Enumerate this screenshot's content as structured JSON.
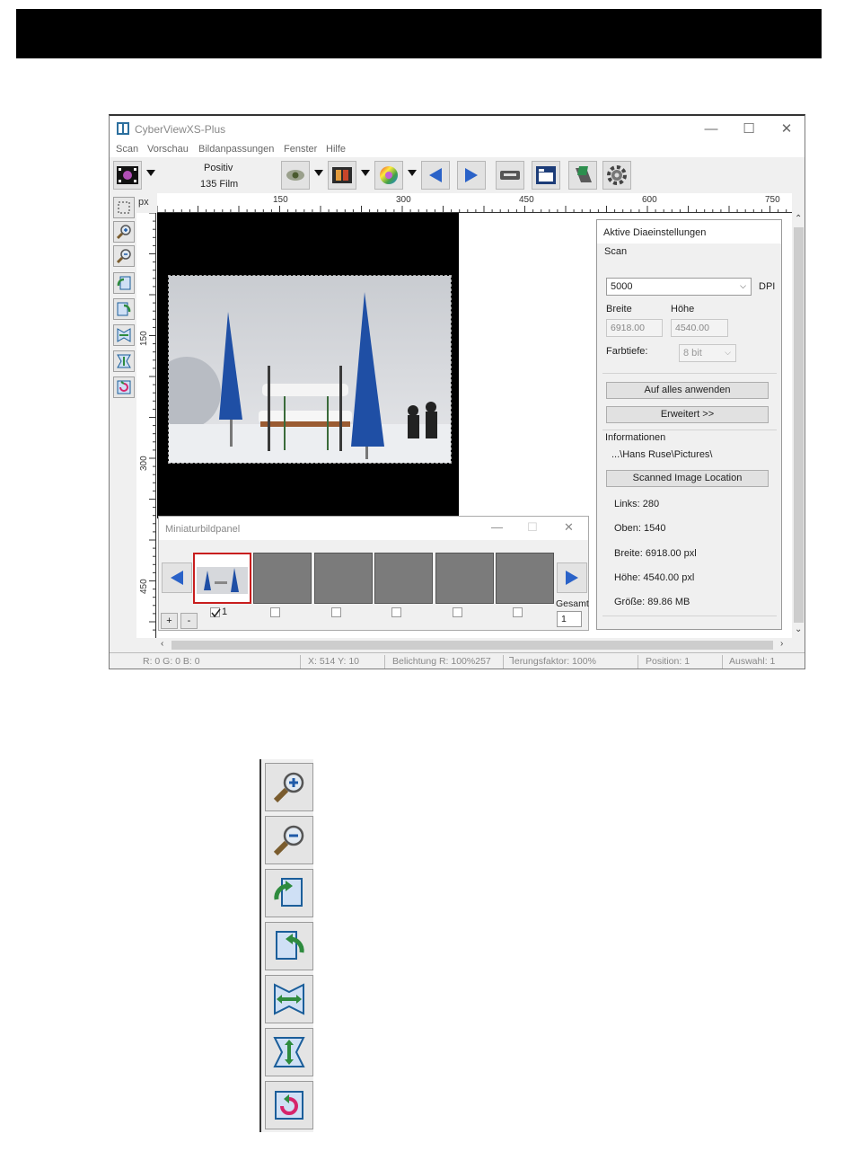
{
  "window": {
    "title": "CyberViewXS-Plus",
    "minimize": "—",
    "maximize": "☐",
    "close": "✕"
  },
  "menu": [
    "Scan",
    "Vorschau",
    "Bildanpassungen",
    "Fenster",
    "Hilfe"
  ],
  "toolbar": {
    "mode_line1": "Positiv",
    "mode_line2": "135 Film"
  },
  "ruler": {
    "unit": "px",
    "h_ticks": [
      "150",
      "300",
      "450",
      "600",
      "750"
    ],
    "v_ticks": [
      "150",
      "300",
      "450"
    ]
  },
  "settings_panel": {
    "title": "Aktive Diaeinstellungen",
    "scan_label": "Scan",
    "dpi_value": "5000",
    "dpi_unit": "DPI",
    "width_label": "Breite",
    "height_label": "Höhe",
    "width_value": "6918.00",
    "height_value": "4540.00",
    "depth_label": "Farbtiefe:",
    "depth_value": "8 bit",
    "apply_all": "Auf alles anwenden",
    "advanced": "Erweitert >>",
    "info_label": "Informationen",
    "path": "...\\Hans Ruse\\Pictures\\",
    "location_button": "Scanned Image Location",
    "left": "Links: 280",
    "top": "Oben: 1540",
    "width_info": "Breite: 6918.00 pxl",
    "height_info": "Höhe: 4540.00 pxl",
    "size_info": "Größe: 89.86 MB"
  },
  "thumbnail_panel": {
    "title": "Miniaturbildpanel",
    "close": "✕",
    "first_frame_number": "1",
    "plus": "+",
    "minus": "-",
    "total_label": "Gesamt",
    "total_value": "1"
  },
  "status": {
    "rgb": "R: 0 G: 0 B: 0",
    "xy": "X: 514 Y: 10",
    "exposure": "Belichtung R: 100%257",
    "factor": "Ꞁerungsfaktor: 100%",
    "position": "Position: 1",
    "selection": "Auswahl: 1"
  },
  "colors": {
    "accent_blue": "#2a62c8",
    "active_frame": "#c81e1e"
  },
  "icons": {
    "left_tools": [
      "select-icon",
      "zoom-in-icon",
      "zoom-out-icon",
      "rotate-left-icon",
      "rotate-right-icon",
      "flip-horizontal-icon",
      "flip-vertical-icon",
      "reset-icon"
    ],
    "zoom_strip": [
      "zoom-in-icon",
      "zoom-out-icon",
      "rotate-left-icon",
      "rotate-right-icon",
      "flip-horizontal-icon",
      "flip-vertical-icon",
      "reset-icon"
    ]
  }
}
